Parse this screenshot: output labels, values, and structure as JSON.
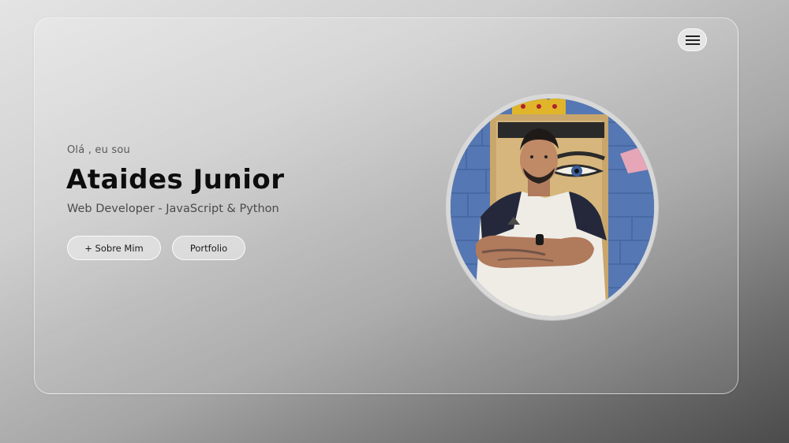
{
  "hero": {
    "intro": "Olá , eu sou",
    "name": "Ataides Junior",
    "role": "Web Developer - JavaScript & Python",
    "about_label": "+ Sobre Mim",
    "portfolio_label": "Portfolio"
  },
  "nav": {
    "menu_icon": "hamburger-menu-icon"
  },
  "profile": {
    "photo_desc_icon": "profile-photo"
  },
  "colors": {
    "text_primary": "#0d0d0d",
    "text_secondary": "#4a4a4a",
    "ring": "#d8d8d8"
  }
}
